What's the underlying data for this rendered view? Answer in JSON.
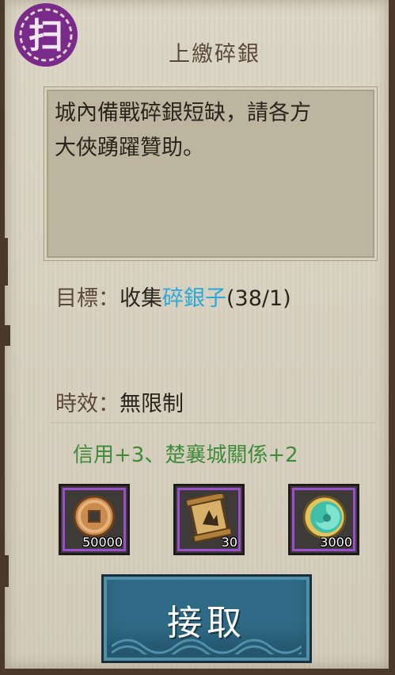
{
  "seal": {
    "glyph": "扫"
  },
  "quest": {
    "title": "上繳碎銀",
    "description_lines": [
      "城內備戰碎銀短缺，請各方",
      "大俠踴躍贊助。"
    ],
    "goal": {
      "label": "目標：",
      "action": "收集",
      "item_name": "碎銀子",
      "progress": "(38/1)"
    },
    "time_limit": {
      "label": "時效：",
      "value": "無限制"
    },
    "reputation_reward": "信用+3、楚襄城關係+2",
    "rewards": [
      {
        "icon": "copper-coin-icon",
        "quantity": "50000"
      },
      {
        "icon": "scroll-icon",
        "quantity": "30"
      },
      {
        "icon": "jade-pendant-icon",
        "quantity": "3000"
      }
    ],
    "accept_label": "接取"
  },
  "colors": {
    "item_highlight": "#2ba9d8",
    "reputation_text": "#3f8b3a",
    "reward_border": "#9b4fcf",
    "seal": "#7a2a8a",
    "accept_button": "#2f6b86"
  }
}
